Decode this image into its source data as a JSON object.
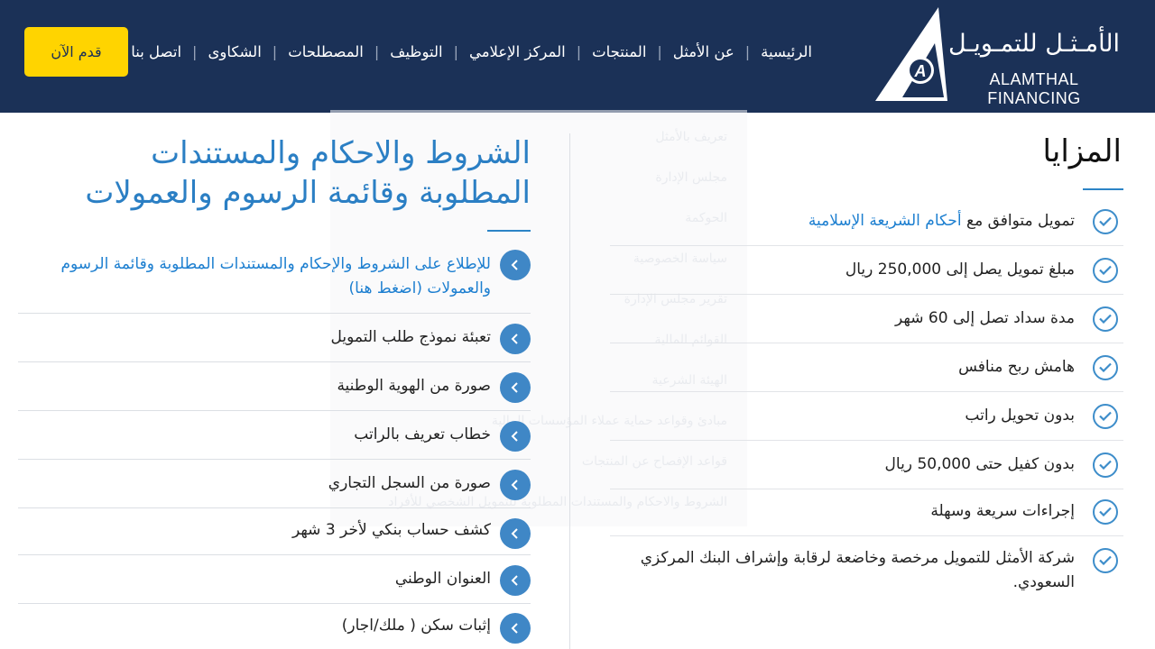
{
  "header": {
    "logo": {
      "arabic": "الأمـثـل للتمـويـل",
      "english": "ALAMTHAL FINANCING",
      "mark_letter": "A"
    },
    "nav": [
      "الرئيسية",
      "عن الأمثل",
      "المنتجات",
      "المركز الإعلامي",
      "التوظيف",
      "المصطلحات",
      "الشكاوى",
      "اتصل بنا"
    ],
    "cta_label": "قدم الآن",
    "colors": {
      "background": "#1b3157",
      "cta": "#ffd400"
    }
  },
  "sidebar_ghost": [
    "تعريف بالأمثل",
    "مجلس الإدارة",
    "الحوكمة",
    "سياسة الخصوصية",
    "تقرير مجلس الإدارة",
    "القوائم المالية",
    "الهيئة الشرعية",
    "مبادئ وقواعد حماية عملاء المؤسسات المالية",
    "قواعد الإفصاح عن المنتجات",
    "الشروط والاحكام والمستندات المطلوبة للتمويل الشخصي للأفراد"
  ],
  "advantages": {
    "title": "المزايا",
    "items": [
      {
        "text": "تمويل متوافق مع ",
        "link": "أحكام الشريعة الإسلامية"
      },
      {
        "text": "مبلغ تمويل يصل إلى 250,000 ريال"
      },
      {
        "text": "مدة سداد تصل إلى 60 شهر"
      },
      {
        "text": "هامش ربح منافس"
      },
      {
        "text": "بدون تحويل راتب"
      },
      {
        "text": "بدون كفيل حتى 50,000 ريال"
      },
      {
        "text": "إجراءات سريعة وسهلة"
      },
      {
        "text": "شركة الأمثل للتمويل مرخصة وخاضعة لرقابة وإشراف البنك المركزي السعودي."
      }
    ]
  },
  "terms": {
    "title": "الشروط والاحكام والمستندات المطلوبة وقائمة الرسوم والعمولات",
    "items": [
      "للإطلاع على الشروط والإحكام والمستندات المطلوبة وقائمة الرسوم والعمولات (اضغط هنا)",
      "تعبئة نموذج طلب التمويل",
      "صورة من الهوية الوطنية",
      "خطاب تعريف بالراتب",
      "صورة من السجل التجاري",
      "كشف حساب بنكي لأخر 3 شهر",
      "العنوان الوطني",
      "إثبات سكن ( ملك/اجار)"
    ]
  },
  "accent_color": "#2b7fc4"
}
